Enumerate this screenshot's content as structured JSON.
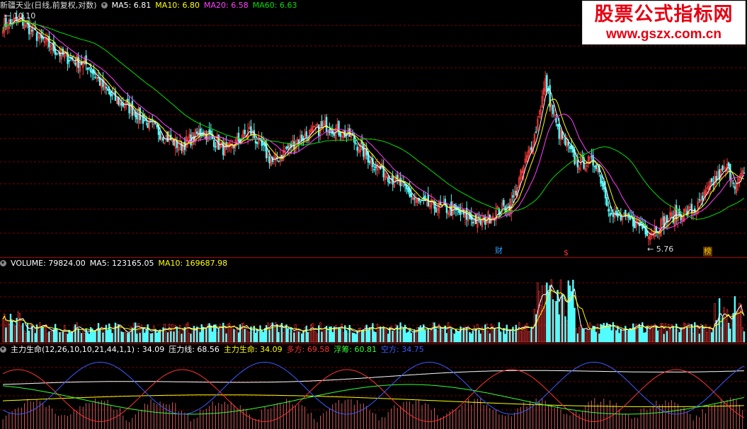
{
  "price_panel": {
    "stock_name": "新疆天业(日线,前复权,对数)",
    "ma5": "MA5: 6.81",
    "ma10": "MA10: 6.80",
    "ma20": "MA20: 6.58",
    "ma60": "MA60: 6.63",
    "high_label": "10.10",
    "low_label": "5.76",
    "event_markers": [
      {
        "text": "财",
        "color": "#33a0ff"
      },
      {
        "text": "$",
        "color": "#ff3333"
      },
      {
        "text": "榜",
        "color": "#ffcc00"
      }
    ]
  },
  "volume_panel": {
    "label": "VOLUME: 79824.00",
    "ma5": "MA5: 123165.05",
    "ma10": "MA10: 169687.98"
  },
  "indicator_panel": {
    "name": "主力生命(12,26,10,10,21,44,1,1) : 34.09",
    "pressure": "压力线: 68.56",
    "life": "主力生命: 34.09",
    "long": "多方: 69.58",
    "float": "浮筹: 60.81",
    "short": "空方: 34.75"
  },
  "watermark": {
    "title": "股票公式指标网",
    "url": "www.gszx.com.cn"
  },
  "colors": {
    "up": "#ff3c3c",
    "down": "#54ffff",
    "ma5": "#ffffff",
    "ma10": "#ffff00",
    "ma20": "#ff40ff",
    "ma60": "#00e000",
    "grid": "#7a0000",
    "pressure": "#ffffff",
    "life": "#ffff00",
    "long": "#ff3333",
    "float": "#33ff33",
    "short": "#3a5cff"
  },
  "chart_data": [
    {
      "type": "candlestick",
      "scale": "log",
      "ylim": [
        5.5,
        10.3
      ],
      "anchors": [
        [
          0,
          10.0
        ],
        [
          12,
          10.1
        ],
        [
          25,
          9.6
        ],
        [
          40,
          9.2
        ],
        [
          55,
          9.0
        ],
        [
          70,
          8.3
        ],
        [
          85,
          8.0
        ],
        [
          100,
          7.6
        ],
        [
          115,
          7.3
        ],
        [
          130,
          7.6
        ],
        [
          145,
          7.2
        ],
        [
          160,
          7.6
        ],
        [
          175,
          7.0
        ],
        [
          190,
          7.4
        ],
        [
          210,
          7.7
        ],
        [
          225,
          7.5
        ],
        [
          240,
          7.0
        ],
        [
          258,
          6.6
        ],
        [
          270,
          6.3
        ],
        [
          290,
          6.2
        ],
        [
          310,
          6.0
        ],
        [
          330,
          6.3
        ],
        [
          345,
          7.5
        ],
        [
          352,
          8.6
        ],
        [
          360,
          7.6
        ],
        [
          372,
          7.0
        ],
        [
          385,
          7.0
        ],
        [
          395,
          6.1
        ],
        [
          410,
          6.0
        ],
        [
          420,
          5.85
        ],
        [
          435,
          6.1
        ],
        [
          450,
          6.2
        ],
        [
          462,
          6.7
        ],
        [
          470,
          6.9
        ],
        [
          476,
          6.6
        ],
        [
          481,
          6.81
        ]
      ],
      "ma_periods": [
        5,
        10,
        20,
        60
      ],
      "high": 10.1,
      "low": 5.76
    },
    {
      "type": "bar",
      "name": "VOLUME",
      "last": 79824.0,
      "ma5": 123165.05,
      "ma10": 169687.98
    },
    {
      "type": "line",
      "name": "主力生命",
      "params": [
        12,
        26,
        10,
        10,
        21,
        44,
        1,
        1
      ],
      "series": [
        {
          "name": "压力线",
          "last": 68.56
        },
        {
          "name": "主力生命",
          "last": 34.09
        },
        {
          "name": "多方",
          "last": 69.58
        },
        {
          "name": "浮筹",
          "last": 60.81
        },
        {
          "name": "空方",
          "last": 34.75
        }
      ]
    }
  ]
}
